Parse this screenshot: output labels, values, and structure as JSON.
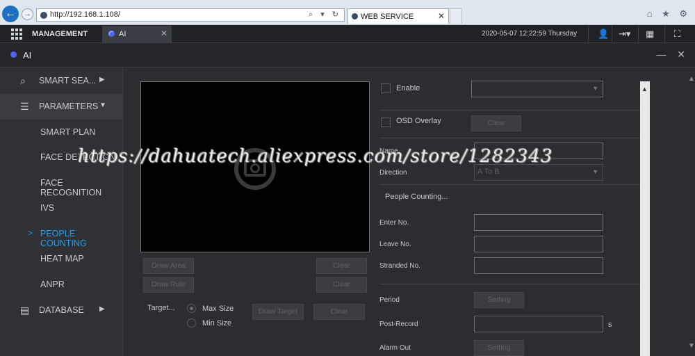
{
  "browser": {
    "url": "http://192.168.1.108/",
    "tab_title": "WEB SERVICE",
    "nav_back": "←",
    "nav_forward": "→",
    "addr_controls": "⌕ ▾ ↻",
    "tab_close": "✕",
    "right_icons": "⌂ ★ ⚙"
  },
  "topbar": {
    "management_label": "MANAGEMENT",
    "ai_tab_label": "AI",
    "ai_tab_close": "✕",
    "datetime": "2020-05-07 12:22:59 Thursday",
    "user_icon": "👤",
    "logout_icon": "⇥▾",
    "qr_icon": "▦",
    "fullscreen_icon": "⛶"
  },
  "panel": {
    "title": "AI",
    "win_controls": "— ✕"
  },
  "sidebar": {
    "items": [
      {
        "label": "SMART SEA...",
        "icon": "⌕",
        "arrow": "▶"
      },
      {
        "label": "PARAMETERS",
        "icon": "☰",
        "arrow": "▼"
      },
      {
        "label": "SMART PLAN"
      },
      {
        "label": "FACE DETECTION"
      },
      {
        "label": "FACE RECOGNITION"
      },
      {
        "label": "IVS"
      },
      {
        "label": "PEOPLE COUNTING",
        "chevron": ">"
      },
      {
        "label": "HEAT MAP"
      },
      {
        "label": "ANPR"
      },
      {
        "label": "DATABASE",
        "icon": "▤",
        "arrow": "▶"
      }
    ]
  },
  "video_panel": {
    "buttons": {
      "draw_area": "Draw Area",
      "clear_1": "Clear",
      "draw_rule": "Draw Rule",
      "clear_2": "Clear",
      "draw_target": "Draw Target",
      "clear_3": "Clear"
    },
    "target_label": "Target...",
    "max_size": "Max Size",
    "min_size": "Min Size"
  },
  "form": {
    "enable_label": "Enable",
    "osd_label": "OSD Overlay",
    "osd_button": "Clear",
    "name_label": "Name",
    "direction_label": "Direction",
    "direction_value": "A To B",
    "people_counting": "People Counting...",
    "enter_no": "Enter No.",
    "leave_no": "Leave No.",
    "stranded_no": "Stranded No.",
    "period_label": "Period",
    "period_button": "Setting",
    "post_record_label": "Post-Record",
    "post_record_unit": "s",
    "alarm_out_label": "Alarm Out",
    "alarm_out_button": "Setting",
    "select_arrow": "▼"
  },
  "scrollbar": {
    "up": "▲",
    "right_up": "▲",
    "right_down": "▼"
  },
  "watermark": "https://dahuatech.aliexpress.com/store/1282343"
}
